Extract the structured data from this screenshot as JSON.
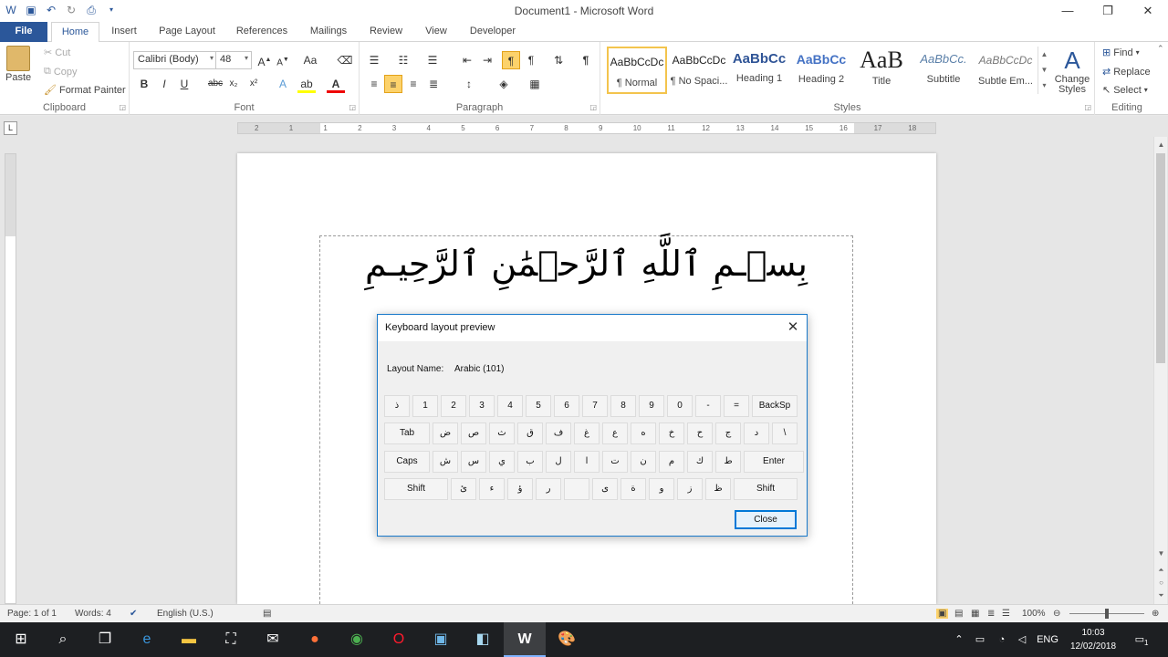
{
  "window": {
    "title": "Document1 - Microsoft Word"
  },
  "qat": {
    "icons": [
      "word-icon",
      "save-icon",
      "undo-icon",
      "redo-icon",
      "print-preview-icon",
      "customize-icon"
    ]
  },
  "tabs": [
    "File",
    "Home",
    "Insert",
    "Page Layout",
    "References",
    "Mailings",
    "Review",
    "View",
    "Developer"
  ],
  "clipboard": {
    "paste": "Paste",
    "cut": "Cut",
    "copy": "Copy",
    "format_painter": "Format Painter",
    "label": "Clipboard"
  },
  "font": {
    "name": "Calibri (Body)",
    "size": "48",
    "label": "Font"
  },
  "paragraph": {
    "label": "Paragraph"
  },
  "styles": {
    "label": "Styles",
    "items": [
      {
        "preview": "AaBbCcDc",
        "name": "¶ Normal"
      },
      {
        "preview": "AaBbCcDc",
        "name": "¶ No Spaci..."
      },
      {
        "preview": "AaBbCc",
        "name": "Heading 1"
      },
      {
        "preview": "AaBbCc",
        "name": "Heading 2"
      },
      {
        "preview": "AaB",
        "name": "Title"
      },
      {
        "preview": "AaBbCc.",
        "name": "Subtitle"
      },
      {
        "preview": "AaBbCcDc",
        "name": "Subtle Em..."
      }
    ],
    "change_styles": "Change Styles"
  },
  "editing": {
    "find": "Find",
    "replace": "Replace",
    "select": "Select",
    "label": "Editing"
  },
  "ruler": {
    "ticks": [
      "2",
      "1",
      "1",
      "2",
      "3",
      "4",
      "5",
      "6",
      "7",
      "8",
      "9",
      "10",
      "11",
      "12",
      "13",
      "14",
      "15",
      "16",
      "17",
      "18"
    ]
  },
  "document": {
    "text": "بِسۡـمِ ٱللَّهِ ٱلرَّحۡمَٰنِ ٱلرَّحِيـمِ"
  },
  "dialog": {
    "title": "Keyboard layout preview",
    "layout_label": "Layout Name:",
    "layout_value": "Arabic (101)",
    "row1": [
      "ذ",
      "1",
      "2",
      "3",
      "4",
      "5",
      "6",
      "7",
      "8",
      "9",
      "0",
      "-",
      "=",
      "BackSp"
    ],
    "row2": [
      "Tab",
      "ض",
      "ص",
      "ث",
      "ق",
      "ف",
      "غ",
      "ع",
      "ه",
      "خ",
      "ح",
      "ج",
      "د",
      "\\"
    ],
    "row3": [
      "Caps",
      "ش",
      "س",
      "ي",
      "ب",
      "ل",
      "ا",
      "ت",
      "ن",
      "م",
      "ك",
      "ط",
      "Enter"
    ],
    "row4": [
      "Shift",
      "ئ",
      "ء",
      "ؤ",
      "ر",
      "",
      "ى",
      "ة",
      "و",
      "ز",
      "ظ",
      "Shift"
    ],
    "close": "Close"
  },
  "status": {
    "page": "Page: 1 of 1",
    "words": "Words: 4",
    "language": "English (U.S.)",
    "zoom": "100%"
  },
  "taskbar": {
    "lang": "ENG",
    "time": "10:03",
    "date": "12/02/2018",
    "notifications": "1"
  }
}
